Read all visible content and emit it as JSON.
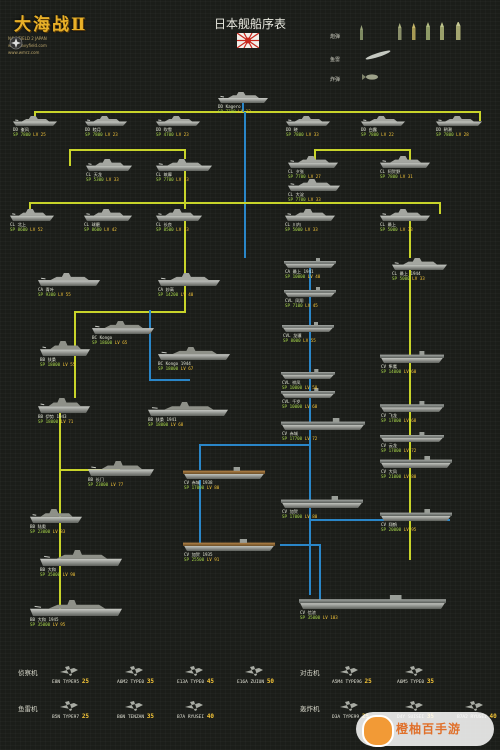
{
  "header": {
    "logo_title": "大海战Ⅱ",
    "logo_lines": [
      "NAVYFIELD 2 JAPAN",
      "www.navyfield.com",
      "www.wmrz.com"
    ],
    "title": "日本舰船序表"
  },
  "ammo_legend": {
    "items": [
      {
        "label": "炮弹"
      },
      {
        "label": "鱼雷"
      },
      {
        "label": "炸弹"
      }
    ]
  },
  "ships": [
    {
      "id": "dd_kagero",
      "name": "DD Kagero",
      "stats": "SP 7700",
      "lv": "12"
    },
    {
      "id": "dd_minekaze",
      "name": "DD 峯风",
      "stats": "SP 7800",
      "lv": "25"
    },
    {
      "id": "dd_mutsuki",
      "name": "DD 睦月",
      "stats": "SP 7800",
      "lv": "23"
    },
    {
      "id": "dd_fubuki",
      "name": "DD 吹雪",
      "stats": "SP 4700",
      "lv": "23"
    },
    {
      "id": "dd_akatsuki",
      "name": "DD 晓",
      "stats": "SP 7800",
      "lv": "33"
    },
    {
      "id": "dd_shiratsuyu",
      "name": "DD 白露",
      "stats": "SP 7800",
      "lv": "22"
    },
    {
      "id": "dd_asashio",
      "name": "DD 朝潮",
      "stats": "SP 7800",
      "lv": "28"
    },
    {
      "id": "cl_tenryu",
      "name": "CL 天龙",
      "stats": "SP 5300",
      "lv": "33"
    },
    {
      "id": "cl_chikuma",
      "name": "CL 筑摩",
      "stats": "SP 7700",
      "lv": "33"
    },
    {
      "id": "cl_yubari",
      "name": "CL 夕张",
      "stats": "SP 7700",
      "lv": "27"
    },
    {
      "id": "cl_agano",
      "name": "CL 阿贺野",
      "stats": "SP 7800",
      "lv": "31"
    },
    {
      "id": "cl_oyodo",
      "name": "CL 大淀",
      "stats": "SP 7700",
      "lv": "33"
    },
    {
      "id": "cl_kitakami",
      "name": "CL 北上",
      "stats": "SP 8600",
      "lv": "52"
    },
    {
      "id": "cl_kuma",
      "name": "CL 球磨",
      "stats": "SP 8600",
      "lv": "42"
    },
    {
      "id": "cl_nagara",
      "name": "CL 长良",
      "stats": "SP 8500",
      "lv": "33"
    },
    {
      "id": "cl_sendai",
      "name": "CL 川内",
      "stats": "SP 5000",
      "lv": "33"
    },
    {
      "id": "cl_mogami",
      "name": "CL 最上",
      "stats": "SP 5000",
      "lv": "33"
    },
    {
      "id": "cl_mogami44",
      "name": "CL 最上 1944",
      "stats": "SP 5000",
      "lv": "33"
    },
    {
      "id": "ca_aoba",
      "name": "CA 青叶",
      "stats": "SP 9300",
      "lv": "55"
    },
    {
      "id": "ca_myoko",
      "name": "CA 妙高",
      "stats": "SP 14200",
      "lv": "40"
    },
    {
      "id": "ca_mogami41",
      "name": "CA 最上 1941",
      "stats": "SP 10000",
      "lv": "40"
    },
    {
      "id": "cvl_hosho",
      "name": "CVL 凤翔",
      "stats": "SP 7100",
      "lv": "45"
    },
    {
      "id": "bc_kongo",
      "name": "BC Kongo",
      "stats": "SP 18600",
      "lv": "65"
    },
    {
      "id": "cvl_ryujo",
      "name": "CVL 龙骧",
      "stats": "SP 8000",
      "lv": "55"
    },
    {
      "id": "bb_fuso",
      "name": "BB 扶桑",
      "stats": "SP 18000",
      "lv": "55"
    },
    {
      "id": "bc_kongo44",
      "name": "BC Kongo 1944",
      "stats": "SP 18000",
      "lv": "67"
    },
    {
      "id": "cvl_shoho",
      "name": "CVL 祥凤",
      "stats": "SP 10000",
      "lv": "50"
    },
    {
      "id": "cv_junyo",
      "name": "CV 隼鹰",
      "stats": "SP 14000",
      "lv": "60"
    },
    {
      "id": "cvl_chitose",
      "name": "CVL 千岁",
      "stats": "SP 10000",
      "lv": "68"
    },
    {
      "id": "cv_hiryu",
      "name": "CV 飞龙",
      "stats": "SP 17000",
      "lv": "68"
    },
    {
      "id": "bb_ise",
      "name": "BB 伊势 1943",
      "stats": "SP 18000",
      "lv": "71"
    },
    {
      "id": "bb_fuso41",
      "name": "BB 扶桑 1941",
      "stats": "SP 18000",
      "lv": "68"
    },
    {
      "id": "cv_akagi",
      "name": "CV 赤城",
      "stats": "SP 17700",
      "lv": "72"
    },
    {
      "id": "cv_unryu",
      "name": "CV 云龙",
      "stats": "SP 17000",
      "lv": "72"
    },
    {
      "id": "bb_nagato",
      "name": "BB 长门",
      "stats": "SP 23000",
      "lv": "77"
    },
    {
      "id": "cv_akagi38",
      "name": "CV 赤城 1938",
      "stats": "SP 17000",
      "lv": "80"
    },
    {
      "id": "cv_taiho",
      "name": "CV 大凤",
      "stats": "SP 21000",
      "lv": "80"
    },
    {
      "id": "cv_kaga",
      "name": "CV 加贺",
      "stats": "SP 17000",
      "lv": "80"
    },
    {
      "id": "bb_mutsu",
      "name": "BB 陆奥",
      "stats": "SP 23000",
      "lv": "83"
    },
    {
      "id": "cv_kaga35",
      "name": "CV 加贺 1935",
      "stats": "SP 25500",
      "lv": "91"
    },
    {
      "id": "cv_shokaku",
      "name": "CV 翔鹤",
      "stats": "SP 20000",
      "lv": "95"
    },
    {
      "id": "bb_yamato",
      "name": "BB 大和",
      "stats": "SP 35000",
      "lv": "90"
    },
    {
      "id": "bb_yamato45",
      "name": "BB 大和 1945",
      "stats": "SP 35000",
      "lv": "95"
    },
    {
      "id": "cv_shinano",
      "name": "CV 信浓",
      "stats": "SP 35000",
      "lv": "103"
    }
  ],
  "plane_sections": {
    "recon": "侦察机",
    "fighter": "对击机",
    "torpedo": "鱼雷机",
    "bomber": "轰炸机"
  },
  "planes": [
    {
      "name": "E8N TYPE95",
      "num": "25"
    },
    {
      "name": "A6M2 TYPE0",
      "num": "35"
    },
    {
      "name": "E13A TYPE0",
      "num": "45"
    },
    {
      "name": "E16A ZUIUN",
      "num": "50"
    },
    {
      "name": "A5M4 TYPE96",
      "num": "25"
    },
    {
      "name": "A6M5 TYPE0",
      "num": "35"
    },
    {
      "name": "B5N TYPE97",
      "num": "25"
    },
    {
      "name": "B6N TENZAN",
      "num": "35"
    },
    {
      "name": "B7A RYUSEI",
      "num": "40"
    },
    {
      "name": "D3A TYPE99",
      "num": "25"
    },
    {
      "name": "D4Y SUISEI",
      "num": "35"
    },
    {
      "name": "B7A2 RYUSEI",
      "num": "40"
    }
  ],
  "watermark": {
    "text": "橙柚百手游"
  },
  "colors": {
    "line_yellow": "#c8d42a",
    "line_blue": "#2a86c8",
    "stats_green": "#a6d44a",
    "level_gold": "#f2c338",
    "background": "#1b1d19"
  }
}
